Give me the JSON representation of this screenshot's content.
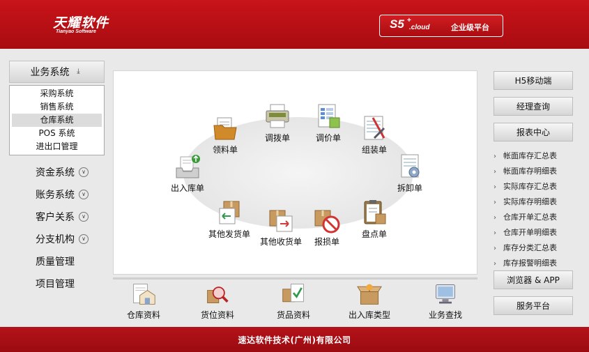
{
  "header": {
    "logo_cn": "天耀软件",
    "logo_en": "Tianyao Software",
    "brand_s5": "S5",
    "brand_plus": "+",
    "brand_cloud": ".cloud",
    "brand_text": "企业级平台",
    "colors": {
      "header_red": "#b8101a",
      "footer_red": "#a50e14"
    }
  },
  "left_nav": {
    "expanded": {
      "label": "业务系统",
      "icon": "chevron-down-icon"
    },
    "sub_items": [
      "采购系统",
      "销售系统",
      "仓库系统",
      "POS 系统",
      "进出口管理"
    ],
    "active_sub": "仓库系统",
    "groups": [
      {
        "label": "资金系统",
        "icon": "chevron-down-icon"
      },
      {
        "label": "账务系统",
        "icon": "chevron-down-icon"
      },
      {
        "label": "客户关系",
        "icon": "chevron-down-icon"
      },
      {
        "label": "分支机构",
        "icon": "chevron-down-icon"
      },
      {
        "label": "质量管理"
      },
      {
        "label": "项目管理"
      }
    ]
  },
  "modules": [
    {
      "label": "领料单",
      "icon": "folder-doc-icon"
    },
    {
      "label": "调拨单",
      "icon": "printer-icon"
    },
    {
      "label": "调价单",
      "icon": "price-sheet-icon"
    },
    {
      "label": "组装单",
      "icon": "assembly-sheet-icon"
    },
    {
      "label": "出入库单",
      "icon": "inbox-tray-icon"
    },
    {
      "label": "拆卸单",
      "icon": "disassembly-sheet-icon"
    },
    {
      "label": "其他发货单",
      "icon": "box-out-icon"
    },
    {
      "label": "其他收货单",
      "icon": "box-in-icon"
    },
    {
      "label": "报损单",
      "icon": "box-damage-icon"
    },
    {
      "label": "盘点单",
      "icon": "clipboard-box-icon"
    }
  ],
  "bottom_modules": [
    {
      "label": "仓库资料",
      "icon": "warehouse-icon"
    },
    {
      "label": "货位资料",
      "icon": "location-search-icon"
    },
    {
      "label": "货品资料",
      "icon": "goods-check-icon"
    },
    {
      "label": "出入库类型",
      "icon": "open-box-icon"
    },
    {
      "label": "业务查找",
      "icon": "monitor-search-icon"
    }
  ],
  "right_panel": {
    "h5": "H5移动端",
    "manager": "经理查询",
    "report_center": "报表中心",
    "reports": [
      "帐面库存汇总表",
      "帐面库存明细表",
      "实际库存汇总表",
      "实际库存明细表",
      "仓库开单汇总表",
      "仓库开单明细表",
      "库存分类汇总表",
      "库存报警明细表"
    ],
    "browser_app": "浏览器 & APP",
    "service": "服务平台"
  },
  "footer": {
    "text": "速达软件技术(广州)有限公司"
  }
}
